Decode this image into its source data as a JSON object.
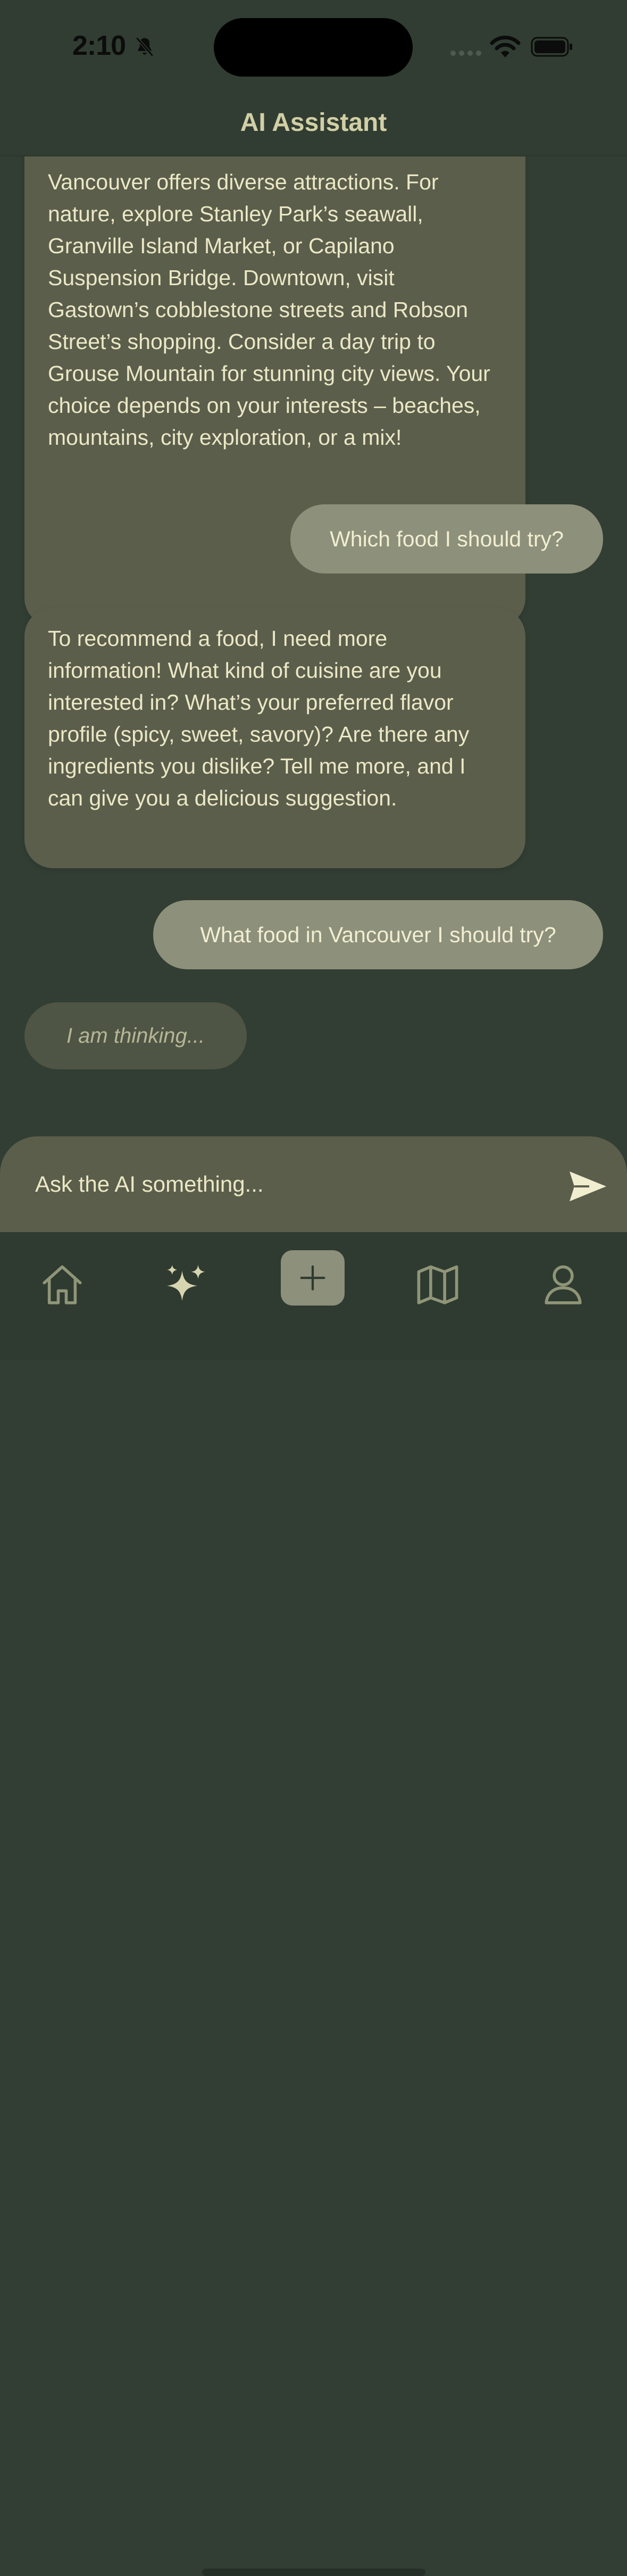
{
  "status_bar": {
    "time": "2:10"
  },
  "header": {
    "title": "AI Assistant"
  },
  "messages": [
    {
      "role": "assistant",
      "text": "Vancouver offers diverse attractions.  For nature, explore Stanley Park’s seawall, Granville Island Market, or Capilano Suspension Bridge.  Downtown, visit Gastown’s cobblestone streets and Robson Street’s shopping.  Consider a day trip to Grouse Mountain for stunning city views.  Your choice depends on your interests –  beaches, mountains, city exploration, or a mix!"
    },
    {
      "role": "user",
      "text": "Which food I should try?"
    },
    {
      "role": "assistant",
      "text": "To recommend a food, I need more information!  What kind of cuisine are you interested in? What’s your preferred flavor profile (spicy, sweet, savory)?  Are there any ingredients you dislike?  Tell me more, and I can give you a delicious suggestion."
    },
    {
      "role": "user",
      "text": "What food in Vancouver I should try?"
    }
  ],
  "thinking": {
    "text": "I am thinking..."
  },
  "composer": {
    "placeholder": "Ask the AI something...",
    "value": ""
  },
  "tabbar": {
    "items": [
      {
        "icon": "home-icon",
        "active": false
      },
      {
        "icon": "sparkles-icon",
        "active": true
      },
      {
        "icon": "plus-icon",
        "active": false
      },
      {
        "icon": "map-icon",
        "active": false
      },
      {
        "icon": "person-icon",
        "active": false
      }
    ]
  },
  "colors": {
    "background": "#323e33",
    "assistant_bubble": "#5b5e4b",
    "user_bubble": "#8d907a",
    "text": "#ebe8c6",
    "accent": "#d2cfa6"
  }
}
